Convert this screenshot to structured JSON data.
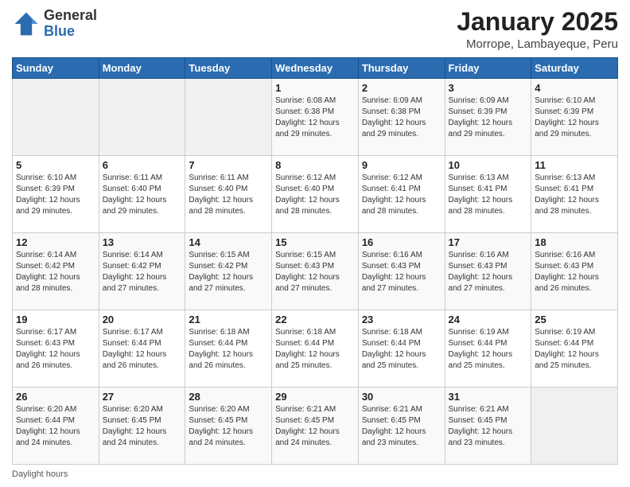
{
  "header": {
    "logo_general": "General",
    "logo_blue": "Blue",
    "title": "January 2025",
    "subtitle": "Morrope, Lambayeque, Peru"
  },
  "days_of_week": [
    "Sunday",
    "Monday",
    "Tuesday",
    "Wednesday",
    "Thursday",
    "Friday",
    "Saturday"
  ],
  "weeks": [
    [
      {
        "day": "",
        "info": ""
      },
      {
        "day": "",
        "info": ""
      },
      {
        "day": "",
        "info": ""
      },
      {
        "day": "1",
        "info": "Sunrise: 6:08 AM\nSunset: 6:38 PM\nDaylight: 12 hours\nand 29 minutes."
      },
      {
        "day": "2",
        "info": "Sunrise: 6:09 AM\nSunset: 6:38 PM\nDaylight: 12 hours\nand 29 minutes."
      },
      {
        "day": "3",
        "info": "Sunrise: 6:09 AM\nSunset: 6:39 PM\nDaylight: 12 hours\nand 29 minutes."
      },
      {
        "day": "4",
        "info": "Sunrise: 6:10 AM\nSunset: 6:39 PM\nDaylight: 12 hours\nand 29 minutes."
      }
    ],
    [
      {
        "day": "5",
        "info": "Sunrise: 6:10 AM\nSunset: 6:39 PM\nDaylight: 12 hours\nand 29 minutes."
      },
      {
        "day": "6",
        "info": "Sunrise: 6:11 AM\nSunset: 6:40 PM\nDaylight: 12 hours\nand 29 minutes."
      },
      {
        "day": "7",
        "info": "Sunrise: 6:11 AM\nSunset: 6:40 PM\nDaylight: 12 hours\nand 28 minutes."
      },
      {
        "day": "8",
        "info": "Sunrise: 6:12 AM\nSunset: 6:40 PM\nDaylight: 12 hours\nand 28 minutes."
      },
      {
        "day": "9",
        "info": "Sunrise: 6:12 AM\nSunset: 6:41 PM\nDaylight: 12 hours\nand 28 minutes."
      },
      {
        "day": "10",
        "info": "Sunrise: 6:13 AM\nSunset: 6:41 PM\nDaylight: 12 hours\nand 28 minutes."
      },
      {
        "day": "11",
        "info": "Sunrise: 6:13 AM\nSunset: 6:41 PM\nDaylight: 12 hours\nand 28 minutes."
      }
    ],
    [
      {
        "day": "12",
        "info": "Sunrise: 6:14 AM\nSunset: 6:42 PM\nDaylight: 12 hours\nand 28 minutes."
      },
      {
        "day": "13",
        "info": "Sunrise: 6:14 AM\nSunset: 6:42 PM\nDaylight: 12 hours\nand 27 minutes."
      },
      {
        "day": "14",
        "info": "Sunrise: 6:15 AM\nSunset: 6:42 PM\nDaylight: 12 hours\nand 27 minutes."
      },
      {
        "day": "15",
        "info": "Sunrise: 6:15 AM\nSunset: 6:43 PM\nDaylight: 12 hours\nand 27 minutes."
      },
      {
        "day": "16",
        "info": "Sunrise: 6:16 AM\nSunset: 6:43 PM\nDaylight: 12 hours\nand 27 minutes."
      },
      {
        "day": "17",
        "info": "Sunrise: 6:16 AM\nSunset: 6:43 PM\nDaylight: 12 hours\nand 27 minutes."
      },
      {
        "day": "18",
        "info": "Sunrise: 6:16 AM\nSunset: 6:43 PM\nDaylight: 12 hours\nand 26 minutes."
      }
    ],
    [
      {
        "day": "19",
        "info": "Sunrise: 6:17 AM\nSunset: 6:43 PM\nDaylight: 12 hours\nand 26 minutes."
      },
      {
        "day": "20",
        "info": "Sunrise: 6:17 AM\nSunset: 6:44 PM\nDaylight: 12 hours\nand 26 minutes."
      },
      {
        "day": "21",
        "info": "Sunrise: 6:18 AM\nSunset: 6:44 PM\nDaylight: 12 hours\nand 26 minutes."
      },
      {
        "day": "22",
        "info": "Sunrise: 6:18 AM\nSunset: 6:44 PM\nDaylight: 12 hours\nand 25 minutes."
      },
      {
        "day": "23",
        "info": "Sunrise: 6:18 AM\nSunset: 6:44 PM\nDaylight: 12 hours\nand 25 minutes."
      },
      {
        "day": "24",
        "info": "Sunrise: 6:19 AM\nSunset: 6:44 PM\nDaylight: 12 hours\nand 25 minutes."
      },
      {
        "day": "25",
        "info": "Sunrise: 6:19 AM\nSunset: 6:44 PM\nDaylight: 12 hours\nand 25 minutes."
      }
    ],
    [
      {
        "day": "26",
        "info": "Sunrise: 6:20 AM\nSunset: 6:44 PM\nDaylight: 12 hours\nand 24 minutes."
      },
      {
        "day": "27",
        "info": "Sunrise: 6:20 AM\nSunset: 6:45 PM\nDaylight: 12 hours\nand 24 minutes."
      },
      {
        "day": "28",
        "info": "Sunrise: 6:20 AM\nSunset: 6:45 PM\nDaylight: 12 hours\nand 24 minutes."
      },
      {
        "day": "29",
        "info": "Sunrise: 6:21 AM\nSunset: 6:45 PM\nDaylight: 12 hours\nand 24 minutes."
      },
      {
        "day": "30",
        "info": "Sunrise: 6:21 AM\nSunset: 6:45 PM\nDaylight: 12 hours\nand 23 minutes."
      },
      {
        "day": "31",
        "info": "Sunrise: 6:21 AM\nSunset: 6:45 PM\nDaylight: 12 hours\nand 23 minutes."
      },
      {
        "day": "",
        "info": ""
      }
    ]
  ],
  "footer": {
    "daylight_label": "Daylight hours"
  }
}
